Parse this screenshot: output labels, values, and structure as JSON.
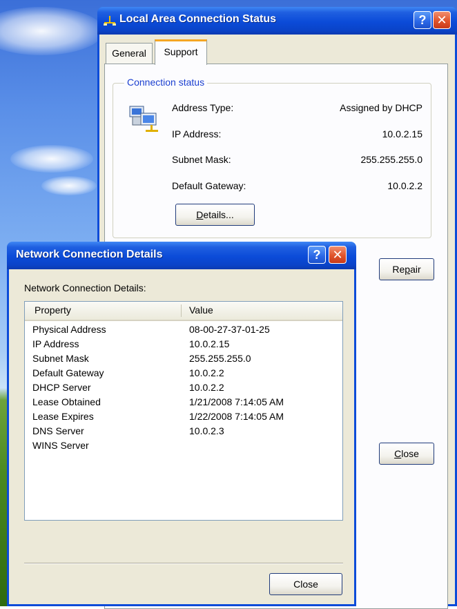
{
  "status_window": {
    "title": "Local Area Connection Status",
    "help_glyph": "?",
    "close_glyph": "✕",
    "tabs": [
      {
        "label": "General",
        "selected": false
      },
      {
        "label": "Support",
        "selected": true
      }
    ],
    "group_title": "Connection status",
    "fields": [
      {
        "label": "Address Type:",
        "value": "Assigned by DHCP"
      },
      {
        "label": "IP Address:",
        "value": "10.0.2.15"
      },
      {
        "label": "Subnet Mask:",
        "value": "255.255.255.0"
      },
      {
        "label": "Default Gateway:",
        "value": "10.0.2.2"
      }
    ],
    "details_button": {
      "mnemonic": "D",
      "rest": "etails..."
    },
    "repair_button": {
      "pre": "Re",
      "mnemonic": "p",
      "post": "air"
    },
    "close_button": {
      "mnemonic": "C",
      "rest": "lose"
    }
  },
  "details_window": {
    "title": "Network Connection Details",
    "help_glyph": "?",
    "close_glyph": "✕",
    "heading": "Network Connection Details:",
    "columns": [
      "Property",
      "Value"
    ],
    "rows": [
      {
        "property": "Physical Address",
        "value": "08-00-27-37-01-25"
      },
      {
        "property": "IP Address",
        "value": "10.0.2.15"
      },
      {
        "property": "Subnet Mask",
        "value": "255.255.255.0"
      },
      {
        "property": "Default Gateway",
        "value": "10.0.2.2"
      },
      {
        "property": "DHCP Server",
        "value": "10.0.2.2"
      },
      {
        "property": "Lease Obtained",
        "value": "1/21/2008 7:14:05 AM"
      },
      {
        "property": "Lease Expires",
        "value": "1/22/2008 7:14:05 AM"
      },
      {
        "property": "DNS Server",
        "value": "10.0.2.3"
      },
      {
        "property": "WINS Server",
        "value": ""
      }
    ],
    "close_button": "Close"
  },
  "icons": {
    "title_icon": "network-connection-icon",
    "status_icon": "network-computers-icon"
  },
  "colors": {
    "titlebar": "#0b4bd8",
    "dialog_face": "#ece9d8",
    "group_title": "#1b3fd0",
    "close_button": "#e0542c",
    "selected_tab_accent": "#f5a623"
  }
}
